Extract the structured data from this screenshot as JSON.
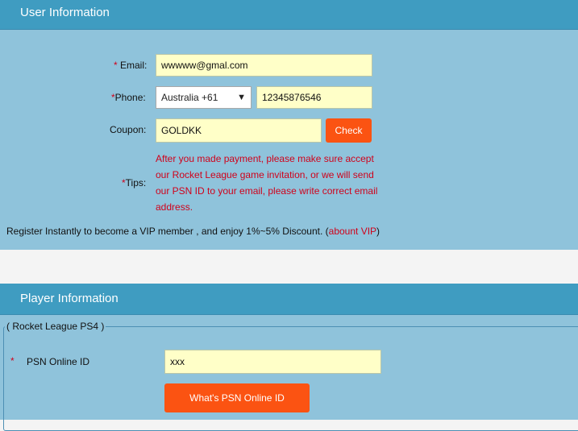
{
  "user_info": {
    "title": "User Information",
    "email": {
      "required_mark": "*",
      "label": " Email:",
      "value": "wwwww@gmal.com"
    },
    "phone": {
      "required_mark": "*",
      "label": "Phone:",
      "country": "Australia +61",
      "value": "12345876546"
    },
    "coupon": {
      "label": "Coupon:",
      "value": "GOLDKK",
      "check_button": "Check"
    },
    "tips": {
      "required_mark": "*",
      "label": "Tips:",
      "lines": [
        "After you made payment, please make sure accept",
        "our Rocket League game invitation, or we will send",
        "our PSN ID to your email, please write correct email",
        "address."
      ]
    },
    "vip_note": {
      "text": "Register Instantly to become a VIP member , and enjoy 1%~5% Discount. (",
      "link": "abount VIP",
      "close": ")"
    }
  },
  "player_info": {
    "title": "Player Information",
    "group_label": "( Rocket League PS4 )",
    "psn": {
      "required_mark": "*",
      "label": "PSN Online ID",
      "value": "xxx"
    },
    "help_button": "What's PSN Online ID"
  }
}
